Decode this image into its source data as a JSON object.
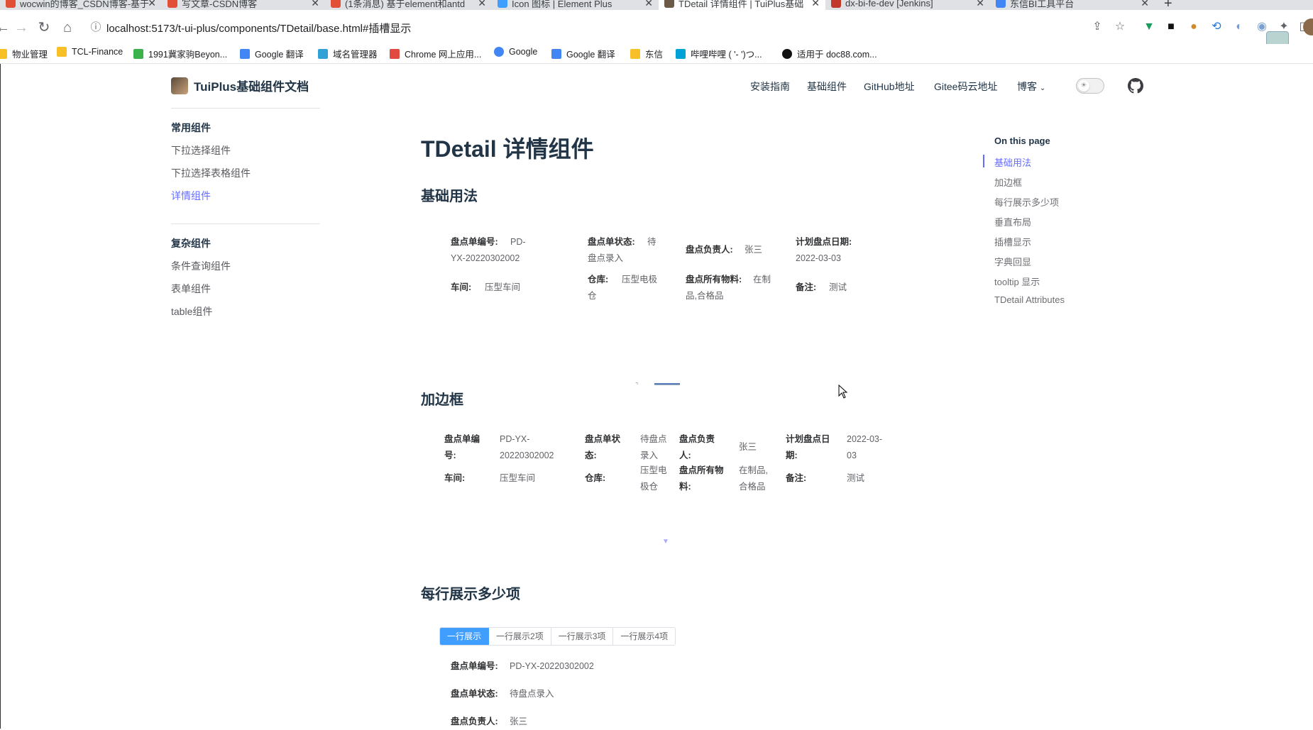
{
  "browser": {
    "tabs": [
      {
        "label": "wocwin的博客_CSDN博客-基于",
        "color": "#e24f37",
        "active": false
      },
      {
        "label": "写文章-CSDN博客",
        "color": "#e24f37",
        "active": false
      },
      {
        "label": "(1条消息) 基于element和antd",
        "color": "#e24f37",
        "active": false
      },
      {
        "label": "Icon 图标 | Element Plus",
        "color": "#409eff",
        "active": false
      },
      {
        "label": "TDetail 详情组件 | TuiPlus基础",
        "color": "#6b5a4a",
        "active": true
      },
      {
        "label": "dx-bi-fe-dev [Jenkins]",
        "color": "#c0392b",
        "active": false
      },
      {
        "label": "东信BI工具平台",
        "color": "#4285f4",
        "active": false
      }
    ],
    "url": "localhost:5173/t-ui-plus/components/TDetail/base.html#插槽显示",
    "bookmarks": [
      {
        "label": "物业管理",
        "color": "#f6c026"
      },
      {
        "label": "TCL-Finance",
        "color": "#f6c026"
      },
      {
        "label": "1991冀家驹Beyon...",
        "color": "#3cb34a"
      },
      {
        "label": "Google 翻译",
        "color": "#4285f4"
      },
      {
        "label": "域名管理器",
        "color": "#31a2d8"
      },
      {
        "label": "Chrome 网上应用...",
        "color": "#e04a3f"
      },
      {
        "label": "Google",
        "color": "#4285f4"
      },
      {
        "label": "Google 翻译",
        "color": "#4285f4"
      },
      {
        "label": "东信",
        "color": "#f6c026"
      },
      {
        "label": "哔哩哔哩 ( '- ')つ...",
        "color": "#00a1d6"
      },
      {
        "label": "适用于 doc88.com...",
        "color": "#111111"
      }
    ]
  },
  "site": {
    "logo": "TuiPlus基础组件文档",
    "nav": [
      "安装指南",
      "基础组件",
      "GitHub地址",
      "Gitee码云地址",
      "博客"
    ],
    "sidebar": {
      "groups": [
        {
          "title": "常用组件",
          "items": [
            "下拉选择组件",
            "下拉选择表格组件",
            "详情组件"
          ],
          "active": "详情组件"
        },
        {
          "title": "复杂组件",
          "items": [
            "条件查询组件",
            "表单组件",
            "table组件"
          ],
          "active": ""
        }
      ]
    },
    "toc": {
      "title": "On this page",
      "items": [
        "基础用法",
        "加边框",
        "每行展示多少项",
        "垂直布局",
        "插槽显示",
        "字典回显",
        "tooltip 显示",
        "TDetail Attributes"
      ],
      "active": "基础用法"
    }
  },
  "content": {
    "title": "TDetail 详情组件",
    "sections": [
      "基础用法",
      "加边框",
      "每行展示多少项"
    ],
    "basic": {
      "row1": [
        {
          "label": "盘点单编号:",
          "value": "PD-YX-20220302002"
        },
        {
          "label": "盘点单状态:",
          "value": "待盘点录入"
        },
        {
          "label": "盘点负责人:",
          "value": "张三"
        },
        {
          "label": "计划盘点日期:",
          "value": "2022-03-03"
        }
      ],
      "row2": [
        {
          "label": "车间:",
          "value": "压型车间"
        },
        {
          "label": "仓库:",
          "value": "压型电极仓"
        },
        {
          "label": "盘点所有物料:",
          "value": "在制品,合格品"
        },
        {
          "label": "备注:",
          "value": "测试"
        }
      ]
    },
    "bordered": {
      "row1": [
        {
          "label": "盘点单编号:",
          "value": "PD-YX-20220302002"
        },
        {
          "label": "盘点单状态:",
          "value": "待盘点录入"
        },
        {
          "label": "盘点负责人:",
          "value": "张三"
        },
        {
          "label": "计划盘点日期:",
          "value": "2022-03-03"
        }
      ],
      "row2": [
        {
          "label": "车间:",
          "value": "压型车间"
        },
        {
          "label": "仓库:",
          "value": "压型电极仓"
        },
        {
          "label": "盘点所有物料:",
          "value": "在制品,合格品"
        },
        {
          "label": "备注:",
          "value": "测试"
        }
      ]
    },
    "per_row": {
      "tabs": [
        "一行展示",
        "一行展示2项",
        "一行展示3项",
        "一行展示4项"
      ],
      "active_tab": "一行展示",
      "items": [
        {
          "label": "盘点单编号:",
          "value": "PD-YX-20220302002"
        },
        {
          "label": "盘点单状态:",
          "value": "待盘点录入"
        },
        {
          "label": "盘点负责人:",
          "value": "张三"
        }
      ]
    }
  }
}
